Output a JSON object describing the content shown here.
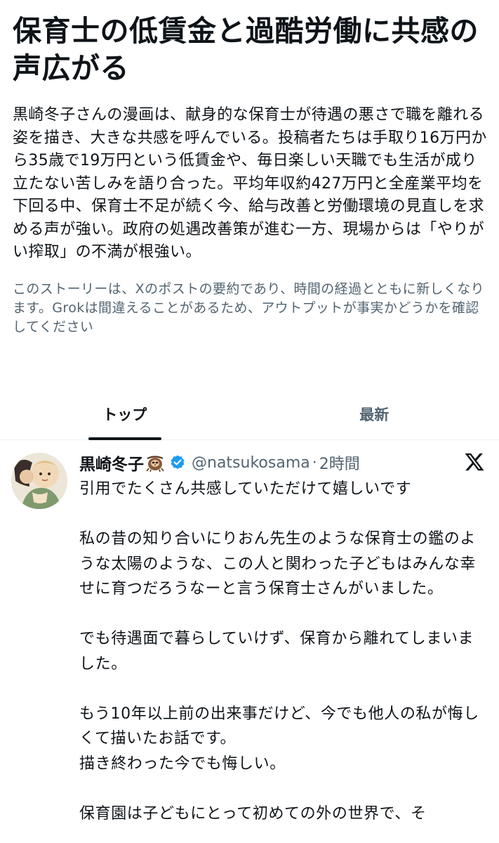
{
  "story": {
    "title": "保育士の低賃金と過酷労働に共感の声広がる",
    "summary": "黒崎冬子さんの漫画は、献身的な保育士が待遇の悪さで職を離れる姿を描き、大きな共感を呼んでいる。投稿者たちは手取り16万円から35歳で19万円という低賃金や、毎日楽しい天職でも生活が成り立たない苦しみを語り合った。平均年収約427万円と全産業平均を下回る中、保育士不足が続く今、給与改善と労働環境の見直しを求める声が強い。政府の処遇改善策が進む一方、現場からは「やりがい搾取」の不満が根強い。",
    "disclaimer": "このストーリーは、Xのポストの要約であり、時間の経過とともに新しくなります。Grokは間違えることがあるため、アウトプットが事実かどうかを確認してください"
  },
  "tabs": [
    {
      "label": "トップ",
      "active": true
    },
    {
      "label": "最新",
      "active": false
    }
  ],
  "post": {
    "author_name": "黒崎冬子",
    "author_emoji": "sloth-emoji",
    "verified_icon": "verified-badge-icon",
    "handle": "@natsukosama",
    "separator": "·",
    "time": "2時間",
    "brand_icon": "x-logo-icon",
    "body": "引用でたくさん共感していただけて嬉しいです\n\n私の昔の知り合いにりおん先生のような保育士の鑑のような太陽のような、この人と関わった子どもはみんな幸せに育つだろうなーと言う保育士さんがいました。\n\nでも待遇面で暮らしていけず、保育から離れてしまいました。\n\nもう10年以上前の出来事だけど、今でも他人の私が悔しくて描いたお話です。\n描き終わった今でも悔しい。\n\n保育園は子どもにとって初めての外の世界で、そ"
  },
  "colors": {
    "text_primary": "#0f1419",
    "text_secondary": "#536471",
    "verified_blue": "#1d9bf0",
    "divider": "#eff3f4"
  }
}
